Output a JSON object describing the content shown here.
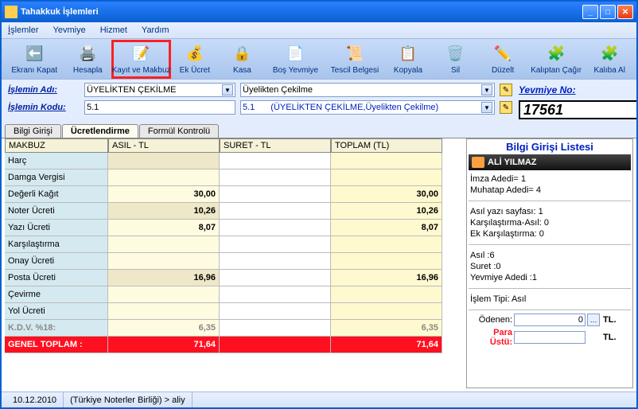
{
  "window": {
    "title": "Tahakkuk İşlemleri"
  },
  "menu": {
    "i0": "İşlemler",
    "i1": "Yevmiye",
    "i2": "Hizmet",
    "i3": "Yardım"
  },
  "toolbar": {
    "b0": "Ekranı Kapat",
    "b1": "Hesapla",
    "b2": "Kayıt ve Makbuz",
    "b3": "Ek Ücret",
    "b4": "Kasa",
    "b5": "Boş Yevmiye",
    "b6": "Tescil Belgesi",
    "b7": "Kopyala",
    "b8": "Sil",
    "b9": "Düzelt",
    "b10": "Kalıptan Çağır",
    "b11": "Kalıba Al"
  },
  "form": {
    "islemAdi_lbl": "İşlemin Adı:",
    "islemAdi_sel": "ÜYELİKTEN ÇEKİLME",
    "uyelik_cekilme": "Üyelikten Çekilme",
    "islemKodu_lbl": "İşlemin Kodu:",
    "islemKodu": "5.1",
    "islemKodu2": "5.1",
    "islemKodu2_paren": "(ÜYELİKTEN ÇEKİLME,Üyelikten Çekilme)",
    "yevmiye_lbl": "Yevmiye No:",
    "yevmiye_no": "17561"
  },
  "tabs": {
    "t0": "Bilgi Girişi",
    "t1": "Ücretlendirme",
    "t2": "Formül Kontrolü"
  },
  "grid": {
    "h0": "MAKBUZ",
    "h1": "ASIL - TL",
    "h2": "SURET - TL",
    "h3": "TOPLAM (TL)",
    "rows": [
      {
        "n": "Harç",
        "a": "",
        "s": "",
        "t": ""
      },
      {
        "n": "Damga Vergisi",
        "a": "",
        "s": "",
        "t": ""
      },
      {
        "n": "Değerli Kağıt",
        "a": "30,00",
        "s": "",
        "t": "30,00"
      },
      {
        "n": "Noter Ücreti",
        "a": "10,26",
        "s": "",
        "t": "10,26"
      },
      {
        "n": "Yazı Ücreti",
        "a": "8,07",
        "s": "",
        "t": "8,07"
      },
      {
        "n": "Karşılaştırma",
        "a": "",
        "s": "",
        "t": ""
      },
      {
        "n": "Onay Ücreti",
        "a": "",
        "s": "",
        "t": ""
      },
      {
        "n": "Posta Ücreti",
        "a": "16,96",
        "s": "",
        "t": "16,96"
      },
      {
        "n": "Çevirme",
        "a": "",
        "s": "",
        "t": ""
      },
      {
        "n": "Yol Ücreti",
        "a": "",
        "s": "",
        "t": ""
      }
    ],
    "kdv_lbl": "K.D.V. %18:",
    "kdv_a": "6,35",
    "kdv_t": "6,35",
    "total_lbl": "GENEL TOPLAM :",
    "total_a": "71,64",
    "total_t": "71,64"
  },
  "side": {
    "title": "Bilgi Girişi Listesi",
    "person": "ALİ YILMAZ",
    "imza": "İmza Adedi= 1",
    "muhatap": "Muhatap Adedi= 4",
    "asilyazi": "Asıl yazı sayfası: 1",
    "kars_asil": "Karşılaştırma-Asıl: 0",
    "ek_kars": "Ek Karşılaştırma: 0",
    "asil": "Asıl :6",
    "suret": "Suret :0",
    "yev_adedi": "Yevmiye Adedi :1",
    "islem_tipi": "İşlem Tipi: Asıl",
    "odenen_lbl": "Ödenen:",
    "odenen_val": "0",
    "paraustu_lbl": "Para Üstü:",
    "tl": "TL."
  },
  "status": {
    "date": "10.12.2010",
    "path": "(Türkiye Noterler Birliği) > aliy"
  }
}
